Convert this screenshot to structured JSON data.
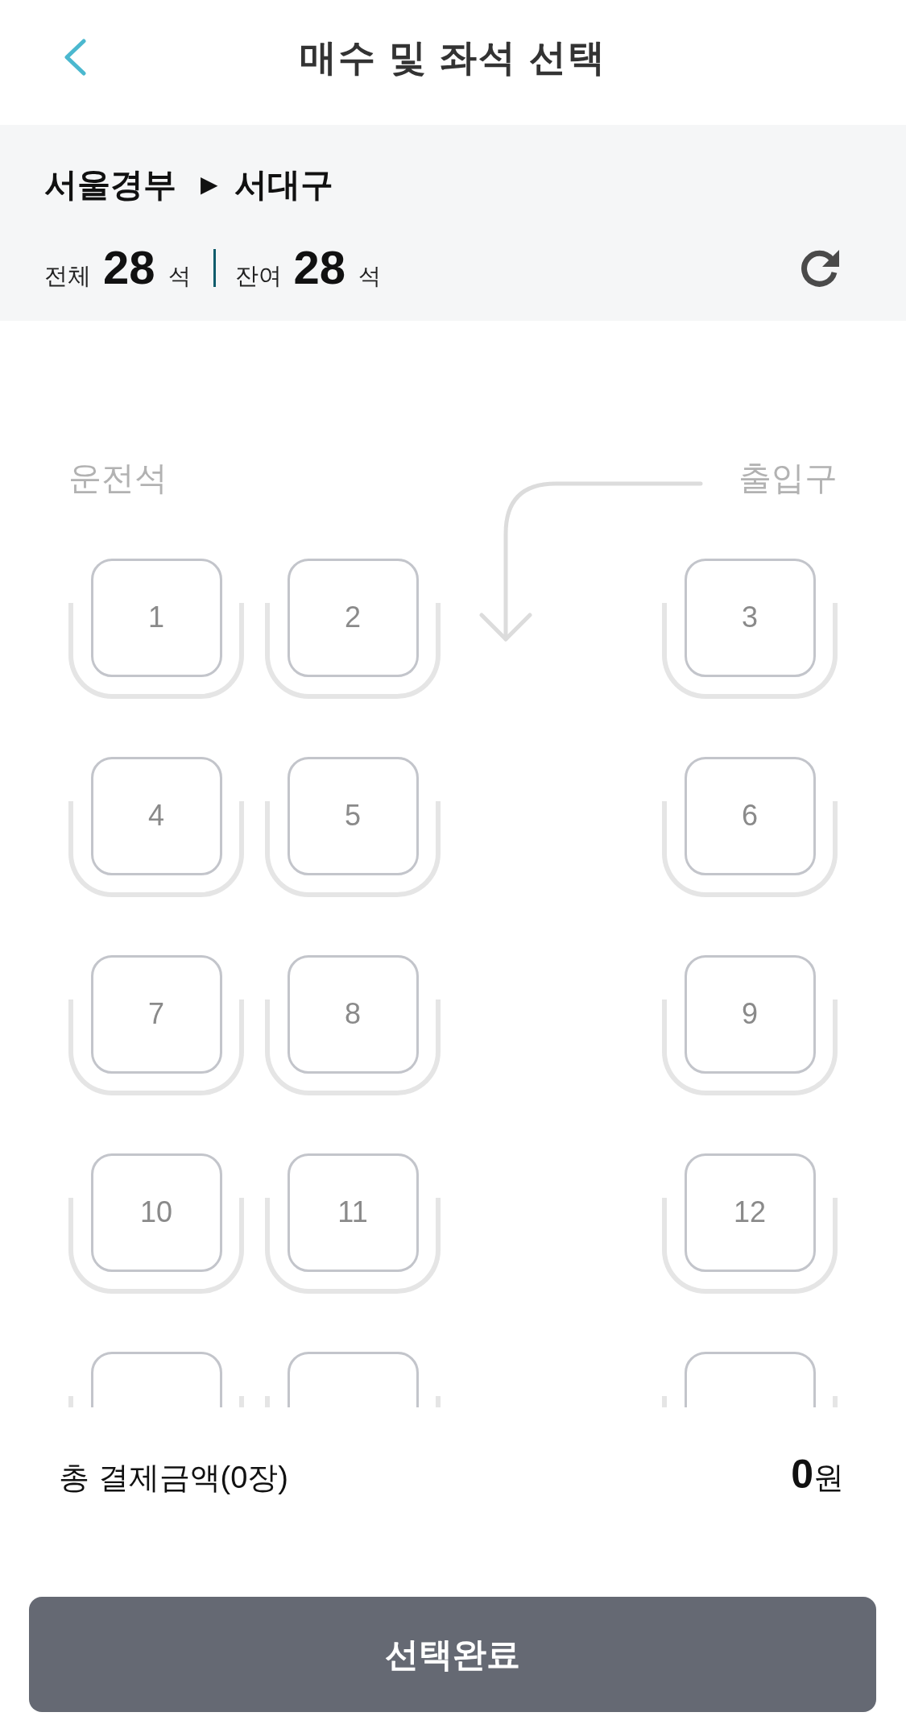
{
  "header": {
    "title": "매수 및 좌석 선택"
  },
  "route": {
    "origin": "서울경부",
    "direction_mark": "▶",
    "destination": "서대구"
  },
  "seat_counts": [
    {
      "label": "전체",
      "value": "28",
      "unit": "석"
    },
    {
      "label": "잔여",
      "value": "28",
      "unit": "석"
    }
  ],
  "seat_map": {
    "front_left_label": "운전석",
    "front_right_label": "출입구",
    "rows": [
      {
        "seats": [
          {
            "label": "1",
            "selected": false
          },
          {
            "label": "2",
            "selected": false
          },
          {
            "label": "3",
            "selected": false
          }
        ]
      },
      {
        "seats": [
          {
            "label": "4",
            "selected": false
          },
          {
            "label": "5",
            "selected": false
          },
          {
            "label": "6",
            "selected": false
          }
        ]
      },
      {
        "seats": [
          {
            "label": "7",
            "selected": false
          },
          {
            "label": "8",
            "selected": false
          },
          {
            "label": "9",
            "selected": false
          }
        ]
      },
      {
        "seats": [
          {
            "label": "10",
            "selected": false
          },
          {
            "label": "11",
            "selected": false
          },
          {
            "label": "12",
            "selected": false
          }
        ]
      },
      {
        "seats": [
          {
            "selected": false
          },
          {
            "selected": false
          },
          {
            "selected": false
          }
        ]
      }
    ]
  },
  "total": {
    "label": "총 결제금액(0장)",
    "amount": "0",
    "currency": "원"
  },
  "confirm_button": {
    "label": "선택완료"
  }
}
